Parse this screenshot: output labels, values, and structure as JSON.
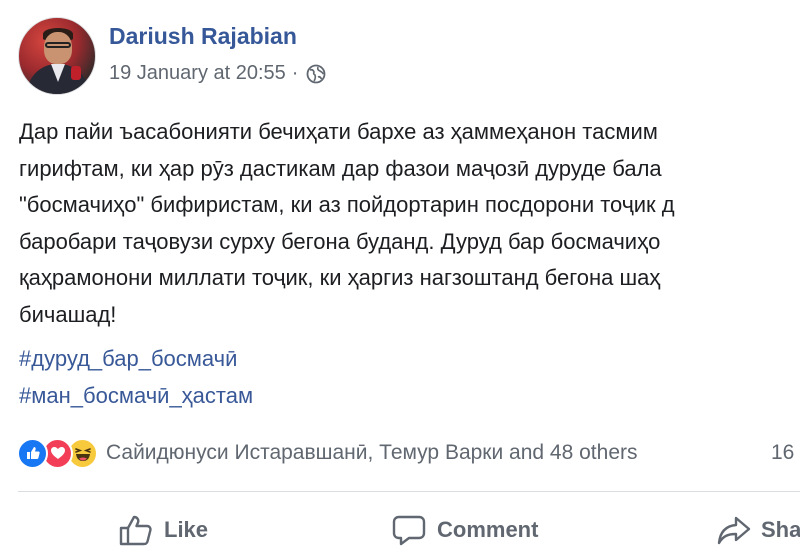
{
  "post": {
    "author": "Dariush Rajabian",
    "timestamp": "19 January at 20:55",
    "separator": "·",
    "privacy_icon": "globe-icon",
    "body_lines": [
      "Дар пайи ъасабонияти бечиҳати бархе аз ҳаммеҳанон тасмим",
      "гирифтам, ки ҳар рӯз дастикам дар фазои маҷозӣ дуруде бала",
      "\"босмачиҳо\" бифиристам, ки аз пойдортарин посдорони тоҷик д",
      "баробари таҷовузи сурху бегона буданд. Дуруд бар босмачиҳо",
      "қаҳрамонони миллати тоҷик, ки ҳаргиз нагзоштанд бегона шаҳ",
      "бичашад!"
    ],
    "hashtags": [
      "#дуруд_бар_босмачӣ",
      "#ман_босмачӣ_ҳастам"
    ]
  },
  "reactions": {
    "icons": [
      "like-reaction-icon",
      "love-reaction-icon",
      "haha-reaction-icon"
    ],
    "names": "Сайидюнуси Истаравшанӣ, Темур Варки and 48 others",
    "comments_count": "16"
  },
  "actions": {
    "like_label": "Like",
    "comment_label": "Comment",
    "share_label": "Sha"
  },
  "colors": {
    "author": "#365899",
    "hashtag": "#385898",
    "meta": "#606770",
    "like": "#1877f2",
    "love": "#f33e58",
    "haha": "#f7c93c"
  }
}
